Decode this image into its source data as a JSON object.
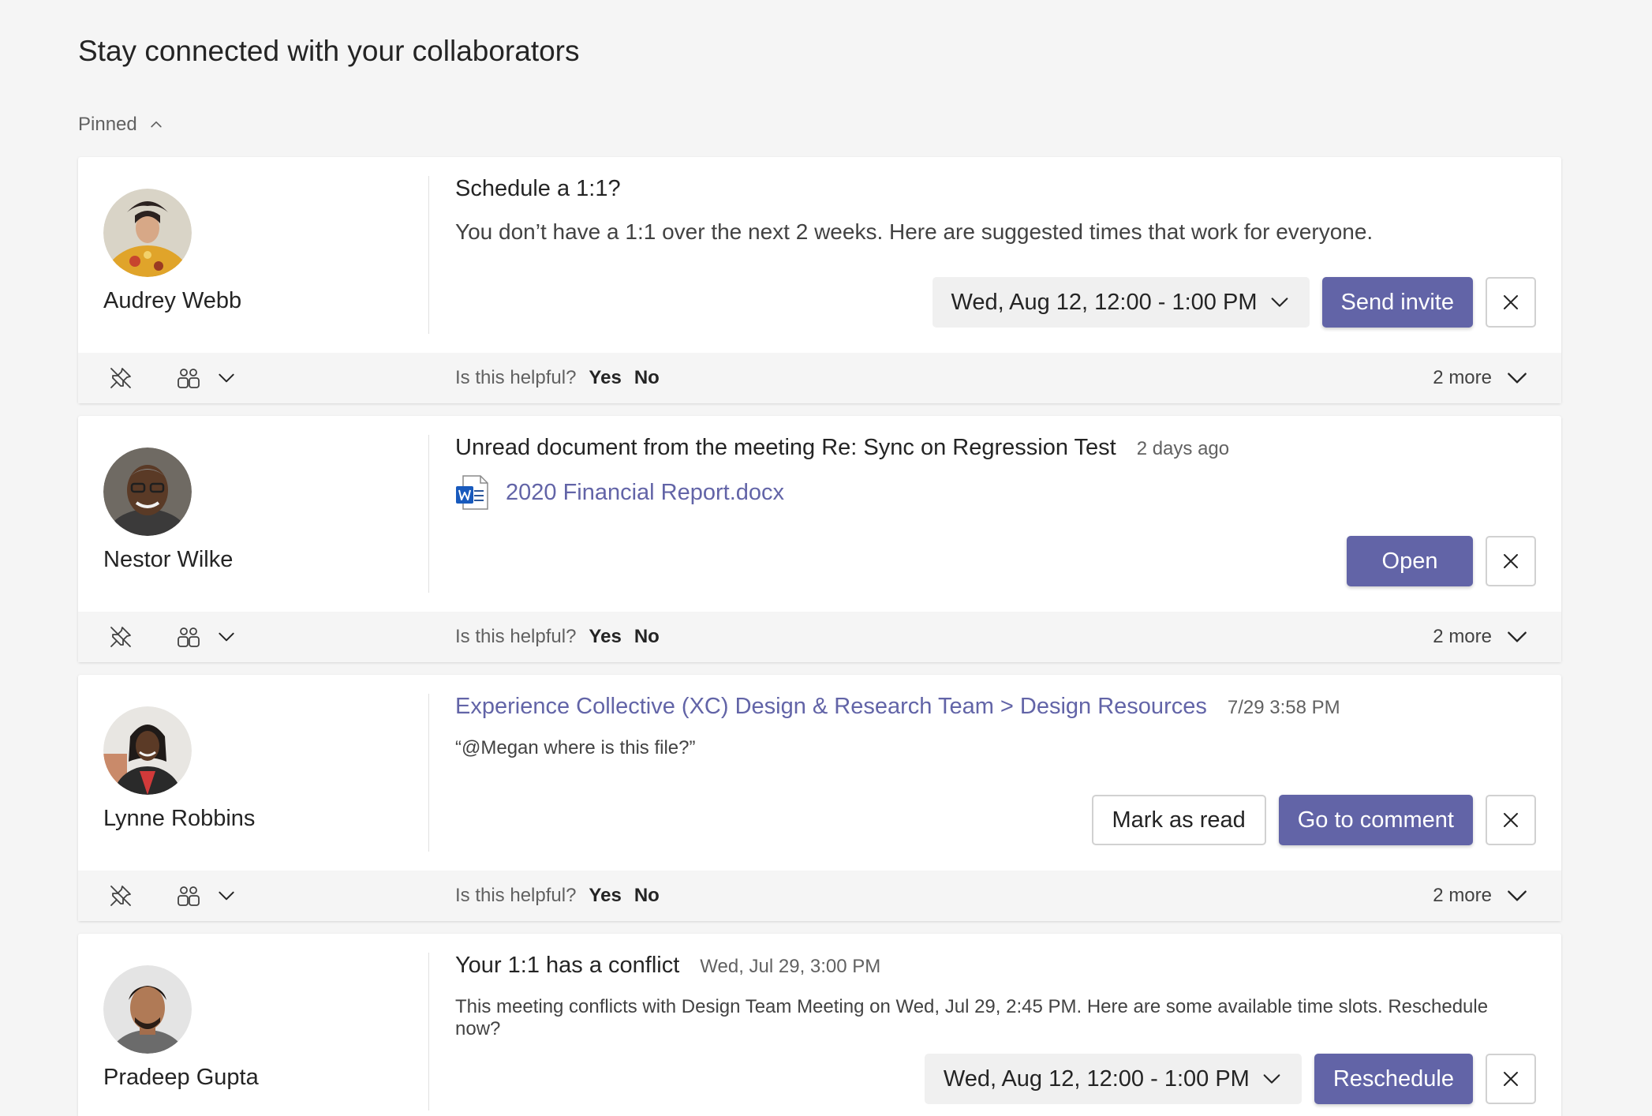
{
  "page": {
    "title": "Stay connected with your collaborators",
    "section_label": "Pinned"
  },
  "icons": {
    "collapse": "chevron-up-icon",
    "unpin": "unpin-icon",
    "people": "people-icon",
    "dropdown": "chevron-down-icon",
    "close": "close-icon",
    "word": "word-document-icon"
  },
  "colors": {
    "accent": "#6264a7",
    "page_bg": "#f5f5f5",
    "card_bg": "#ffffff"
  },
  "feedback": {
    "question": "Is this helpful?",
    "yes": "Yes",
    "no": "No",
    "more": "2 more"
  },
  "cards": [
    {
      "person": "Audrey Webb",
      "title": "Schedule a 1:1?",
      "body": "You don’t have a 1:1 over the next 2 weeks. Here are suggested times that work for everyone.",
      "time_option": "Wed, Aug 12, 12:00 - 1:00 PM",
      "primary_action": "Send invite"
    },
    {
      "person": "Nestor Wilke",
      "title": "Unread document from the meeting Re: Sync on Regression Test",
      "stamp": "2 days ago",
      "file": "2020 Financial Report.docx",
      "primary_action": "Open"
    },
    {
      "person": "Lynne Robbins",
      "title": "Experience Collective (XC) Design & Research Team > Design Resources",
      "stamp": "7/29 3:58 PM",
      "body": "“@Megan where is this file?”",
      "secondary_action": "Mark as read",
      "primary_action": "Go to comment"
    },
    {
      "person": "Pradeep Gupta",
      "title": "Your 1:1 has a conflict",
      "stamp": "Wed, Jul 29, 3:00 PM",
      "body": "This meeting conflicts with Design Team Meeting on Wed, Jul 29, 2:45 PM. Here are some available time slots. Reschedule now?",
      "time_option": "Wed, Aug 12, 12:00 - 1:00 PM",
      "primary_action": "Reschedule"
    }
  ]
}
